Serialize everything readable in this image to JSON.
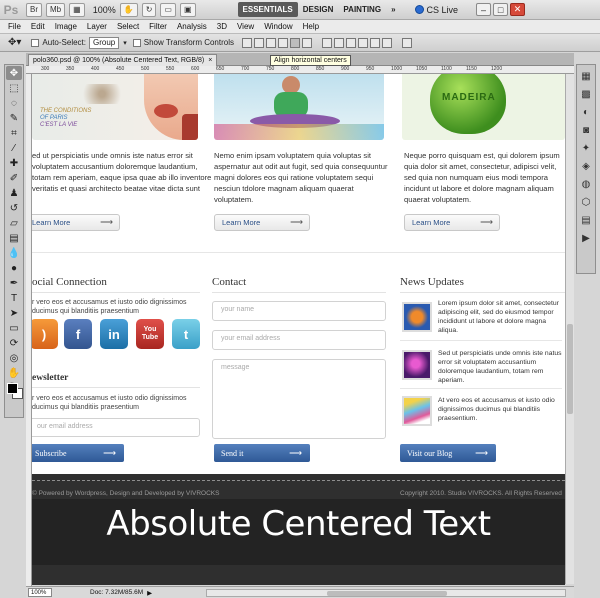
{
  "app": {
    "logo": "Ps",
    "buttons": [
      "Br",
      "Mb"
    ],
    "zoom": "100%",
    "workspaces": [
      "ESSENTIALS",
      "DESIGN",
      "PAINTING"
    ],
    "more": "»",
    "cs_live": "CS Live",
    "window_controls": [
      "–",
      "□",
      "✕"
    ]
  },
  "menu": [
    "File",
    "Edit",
    "Image",
    "Layer",
    "Select",
    "Filter",
    "Analysis",
    "3D",
    "View",
    "Window",
    "Help"
  ],
  "options": {
    "auto_select_label": "Auto-Select:",
    "auto_select_value": "Group",
    "transform_label": "Show Transform Controls",
    "tooltip": "Align horizontal centers"
  },
  "document": {
    "tab_title": "polo360.psd @ 100% (Absolute Centered Text, RGB/8)",
    "tab_close": "×",
    "ruler_marks": [
      "300",
      "350",
      "400",
      "450",
      "500",
      "550",
      "600",
      "650",
      "700",
      "750",
      "800",
      "850",
      "900",
      "950",
      "1000",
      "1050",
      "1100",
      "1150",
      "1200"
    ]
  },
  "page": {
    "columns": [
      {
        "text": "ed ut perspiciatis unde omnis iste natus error sit voluptatem accusantium doloremque laudantium, totam rem aperiam, eaque ipsa quae ab illo inventore veritatis et quasi architecto beatae vitae dicta sunt",
        "button": "Learn More"
      },
      {
        "text": "Nemo enim ipsam voluptatem quia voluptas sit aspernatur aut odit aut fugit, sed quia consequuntur magni dolores eos qui ratione voluptatem sequi nesciun tdolore magnam aliquam quaerat voluptatem.",
        "button": "Learn More"
      },
      {
        "text": "Neque porro quisquam est, qui dolorem ipsum quia dolor sit amet, consectetur, adipisci velit, sed quia non numquam eius modi tempora incidunt ut labore et dolore magnam aliquam quaerat voluptatem.",
        "button": "Learn More"
      }
    ],
    "promo_text": [
      "THE CONDITIONS",
      "OF PARIS",
      "C'EST LA VIE"
    ],
    "hero_word": "MADEIRA",
    "social": {
      "title": "ocial Connection",
      "text": "r vero eos et accusamus et iusto odio dignissimos ducimus qui blanditiis praesentium",
      "icons": [
        "f",
        "in",
        "You Tube",
        "t"
      ]
    },
    "newsletter": {
      "title": "ewsletter",
      "text": "r vero eos et accusamus et iusto odio dignissimos ducimus qui blanditiis praesentium",
      "placeholder": "our email address",
      "button": "Subscribe"
    },
    "contact": {
      "title": "Contact",
      "name_placeholder": "your name",
      "email_placeholder": "your email address",
      "message_placeholder": "message",
      "button": "Send it"
    },
    "news": {
      "title": "News Updates",
      "items": [
        "Lorem ipsum dolor sit amet, consectetur adipiscing elit, sed do eiusmod tempor incididunt ut labore et dolore magna aliqua.",
        "Sed ut perspiciatis unde omnis iste natus error sit voluptatem accusantium doloremque laudantium, totam rem aperiam.",
        "At vero eos et accusamus et iusto odio dignissimos ducimus qui blanditiis praesentium."
      ],
      "button": "Visit our Blog"
    },
    "footer": {
      "left": "© Powered by Wordpress, Design and Developed by VIVROCKS",
      "right": "Copyright 2010. Studio VIVROCKS. All Rights Reserved"
    },
    "overlay_title": "Absolute Centered Text"
  },
  "status": {
    "zoom": "100%",
    "doc": "Doc: 7.32M/85.6M",
    "arrow": "▶"
  }
}
